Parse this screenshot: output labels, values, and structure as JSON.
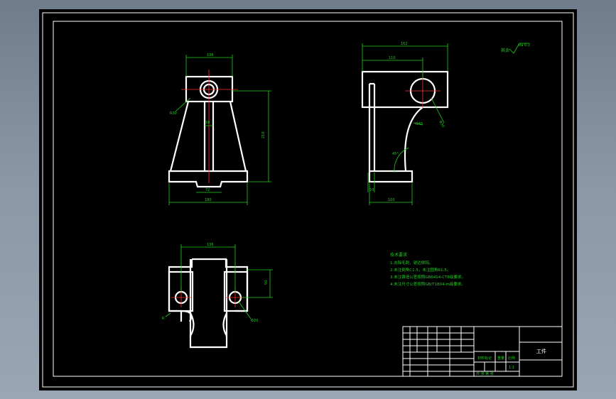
{
  "drawing": {
    "front_view": {
      "dim_top": "136",
      "dim_bottom": "180",
      "dim_slot": "72",
      "dim_height": "210",
      "dim_radius": "R30",
      "dim_rib": "18"
    },
    "side_view": {
      "dim_total": "162",
      "dim_inner": "110",
      "dim_base": "100",
      "dim_radius": "R40",
      "dim_phi": "Φ30",
      "dim_angle": "45°",
      "dim_small": "10"
    },
    "plan_view": {
      "dim_top": "136",
      "dim_side": "50",
      "dim_phi": "Φ20",
      "dim_r": "R"
    },
    "surface_finish": {
      "label": "其余",
      "value": "Ra 6.3"
    },
    "notes": {
      "title": "技术要求",
      "items": [
        "1.去除毛刺、锐边倒钝。",
        "2.未注倒角C1.5，未注圆角R1.5。",
        "3.未注铸造公差按照GB6414-CT8级要求。",
        "4.未注尺寸公差按照GB/T1804-m级要求。"
      ]
    },
    "title_block": {
      "part_name": "工件",
      "material_label": "材料标记",
      "scale_label": "比例",
      "weight_label": "重量",
      "scale_value": "1:1",
      "sheet_info": "共  张  第  张"
    }
  }
}
